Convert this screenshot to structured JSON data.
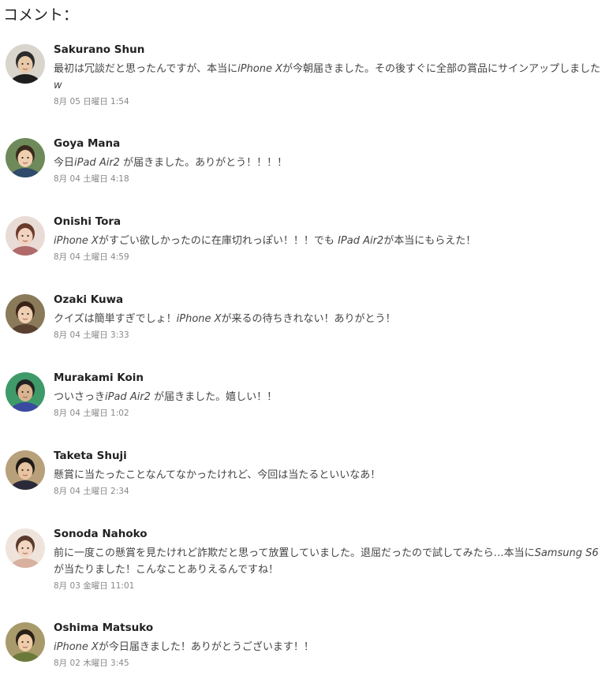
{
  "heading": "コメント：",
  "comments": [
    {
      "name": "Sakurano Shun",
      "date": "8月 05 日曜日 1:54",
      "parts": [
        {
          "t": "最初は冗談だと思ったんですが、本当に"
        },
        {
          "t": "iPhone X",
          "i": true
        },
        {
          "t": "が今朝届きました。その後すぐに全部の賞品にサインアップしました"
        },
        {
          "t": "w",
          "i": true
        }
      ],
      "avatar": {
        "bg": "#d9d4cc",
        "face": "#e8c9a8",
        "hair": "#2b2b2b",
        "cloth": "#1e1e1e"
      }
    },
    {
      "name": "Goya Mana",
      "date": "8月 04 土曜日 4:18",
      "parts": [
        {
          "t": "今日"
        },
        {
          "t": "iPad Air2",
          "i": true
        },
        {
          "t": " が届きました。ありがとう！！！！"
        }
      ],
      "avatar": {
        "bg": "#6f8a5a",
        "face": "#f0cfae",
        "hair": "#3a2a1e",
        "cloth": "#2f4a6a"
      }
    },
    {
      "name": "Onishi Tora",
      "date": "8月 04 土曜日 4:59",
      "parts": [
        {
          "t": "iPhone X",
          "i": true
        },
        {
          "t": "がすごい欲しかったのに在庫切れっぽい！！！でも "
        },
        {
          "t": "IPad Air2",
          "i": true
        },
        {
          "t": "が本当にもらえた！"
        }
      ],
      "avatar": {
        "bg": "#e9dcd6",
        "face": "#f2d3c0",
        "hair": "#6a3a2a",
        "cloth": "#b06a6a"
      }
    },
    {
      "name": "Ozaki Kuwa",
      "date": "8月 04 土曜日 3:33",
      "parts": [
        {
          "t": "クイズは簡単すぎでしょ！"
        },
        {
          "t": "iPhone X",
          "i": true
        },
        {
          "t": "が来るの待ちきれない！ありがとう！"
        }
      ],
      "avatar": {
        "bg": "#8a7a5a",
        "face": "#efcfb2",
        "hair": "#3a2418",
        "cloth": "#5a4030"
      }
    },
    {
      "name": "Murakami Koin",
      "date": "8月 04 土曜日 1:02",
      "parts": [
        {
          "t": "ついさっき"
        },
        {
          "t": "iPad Air2",
          "i": true
        },
        {
          "t": " が届きました。嬉しい！！"
        }
      ],
      "avatar": {
        "bg": "#3f9a6a",
        "face": "#d9b48f",
        "hair": "#222222",
        "cloth": "#3a4aa0"
      }
    },
    {
      "name": "Taketa Shuji",
      "date": "8月 04 土曜日 2:34",
      "parts": [
        {
          "t": "懸賞に当たったことなんてなかったけれど、今回は当たるといいなあ！"
        }
      ],
      "avatar": {
        "bg": "#b8a07a",
        "face": "#e8c4a0",
        "hair": "#1e1a16",
        "cloth": "#2a2a3a"
      }
    },
    {
      "name": "Sonoda Nahoko",
      "date": "8月 03 金曜日 11:01",
      "parts": [
        {
          "t": "前に一度この懸賞を見たけれど詐欺だと思って放置していました。退屈だったので試してみたら…本当に"
        },
        {
          "t": "Samsung S6",
          "i": true
        },
        {
          "t": "が当たりました！こんなことありえるんですね！"
        }
      ],
      "avatar": {
        "bg": "#efe4dc",
        "face": "#f3d6c2",
        "hair": "#5a3a2a",
        "cloth": "#d8b0a0"
      }
    },
    {
      "name": "Oshima Matsuko",
      "date": "8月 02 木曜日 3:45",
      "parts": [
        {
          "t": "iPhone X",
          "i": true
        },
        {
          "t": "が今日届きました！ありがとうございます！！"
        }
      ],
      "avatar": {
        "bg": "#a89a6a",
        "face": "#f0cda8",
        "hair": "#2a2018",
        "cloth": "#6a7a3a"
      }
    }
  ]
}
